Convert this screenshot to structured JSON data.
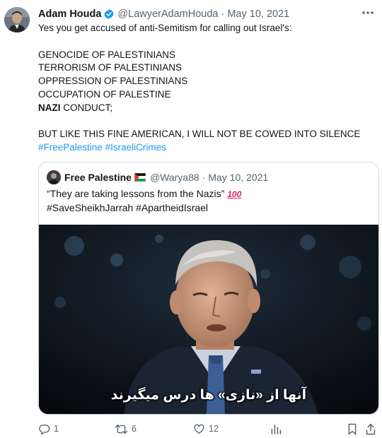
{
  "tweet": {
    "author_name": "Adam Houda",
    "author_handle": "@LawyerAdamHouda",
    "separator": "·",
    "date": "May 10, 2021",
    "body_lines": [
      "Yes you get accused of anti-Semitism for calling out Israel's:",
      "GENOCIDE OF PALESTINIANS",
      "TERRORISM OF PALESTINIANS",
      "OPPRESSION OF PALESTINIANS",
      "OCCUPATION OF PALESTINE",
      "NAZI",
      " CONDUCT;",
      "BUT LIKE THIS FINE AMERICAN, I WILL NOT BE COWED INTO SILENCE"
    ],
    "hashtags": [
      "#FreePalestine",
      "#IsraeliCrimes"
    ]
  },
  "quote": {
    "author_name": "Free Palestine",
    "author_handle": "@Warya88",
    "separator": "·",
    "date": "May 10, 2021",
    "text": "“They are taking lessons from the Nazis”",
    "emoji": "100",
    "hashtags": [
      "#SaveSheikhJarrah",
      "#ApartheidIsrael"
    ],
    "video_subtitle": "آنها از «نازی» ها درس میگیرند"
  },
  "actions": {
    "reply_count": "1",
    "retweet_count": "6",
    "like_count": "12"
  },
  "colors": {
    "link": "#1d9bf0",
    "verified": "#1d9bf0",
    "muted": "#536471",
    "border": "#cfd9de"
  },
  "icons": [
    "verified-badge-icon",
    "more-icon",
    "palestine-flag-icon",
    "reply-icon",
    "retweet-icon",
    "like-icon",
    "views-icon",
    "bookmark-icon",
    "share-icon"
  ]
}
